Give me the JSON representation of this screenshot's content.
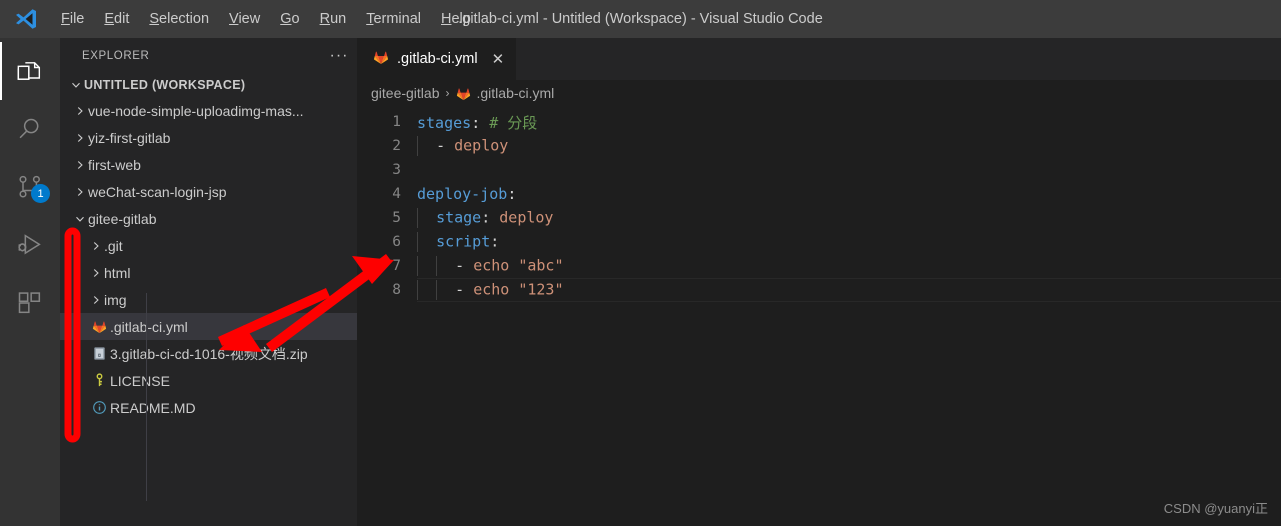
{
  "window": {
    "title": ".gitlab-ci.yml - Untitled (Workspace) - Visual Studio Code",
    "logo_icon": "vscode-logo-icon"
  },
  "menubar": {
    "items": [
      {
        "label": "File",
        "mnemonic": "F",
        "rest": "ile"
      },
      {
        "label": "Edit",
        "mnemonic": "E",
        "rest": "dit"
      },
      {
        "label": "Selection",
        "mnemonic": "S",
        "rest": "election"
      },
      {
        "label": "View",
        "mnemonic": "V",
        "rest": "iew"
      },
      {
        "label": "Go",
        "mnemonic": "G",
        "rest": "o"
      },
      {
        "label": "Run",
        "mnemonic": "R",
        "rest": "un"
      },
      {
        "label": "Terminal",
        "mnemonic": "T",
        "rest": "erminal"
      },
      {
        "label": "Help",
        "mnemonic": "H",
        "rest": "elp"
      }
    ]
  },
  "activitybar": {
    "items": [
      {
        "name": "explorer",
        "icon": "files-icon",
        "active": true,
        "badge": ""
      },
      {
        "name": "search",
        "icon": "search-icon",
        "active": false,
        "badge": ""
      },
      {
        "name": "source-control",
        "icon": "source-control-icon",
        "active": false,
        "badge": "1"
      },
      {
        "name": "run-and-debug",
        "icon": "run-debug-icon",
        "active": false,
        "badge": ""
      },
      {
        "name": "extensions",
        "icon": "extensions-icon",
        "active": false,
        "badge": ""
      }
    ]
  },
  "sidebar": {
    "title": "EXPLORER",
    "more_actions": "···",
    "workspace_root": "UNTITLED (WORKSPACE)",
    "tree": [
      {
        "label": "vue-node-simple-uploadimg-mas...",
        "type": "folder",
        "expanded": false,
        "depth": 1,
        "icon": "chevron-right-icon"
      },
      {
        "label": "yiz-first-gitlab",
        "type": "folder",
        "expanded": false,
        "depth": 1,
        "icon": "chevron-right-icon"
      },
      {
        "label": "first-web",
        "type": "folder",
        "expanded": false,
        "depth": 1,
        "icon": "chevron-right-icon"
      },
      {
        "label": "weChat-scan-login-jsp",
        "type": "folder",
        "expanded": false,
        "depth": 1,
        "icon": "chevron-right-icon"
      },
      {
        "label": "gitee-gitlab",
        "type": "folder",
        "expanded": true,
        "depth": 1,
        "icon": "chevron-down-icon"
      },
      {
        "label": ".git",
        "type": "folder",
        "expanded": false,
        "depth": 2,
        "icon": "chevron-right-icon"
      },
      {
        "label": "html",
        "type": "folder",
        "expanded": false,
        "depth": 2,
        "icon": "chevron-right-icon"
      },
      {
        "label": "img",
        "type": "folder",
        "expanded": false,
        "depth": 2,
        "icon": "chevron-right-icon"
      },
      {
        "label": ".gitlab-ci.yml",
        "type": "file",
        "depth": 2,
        "icon": "gitlab-fox-icon",
        "selected": true
      },
      {
        "label": "3.gitlab-ci-cd-1016-视频文档.zip",
        "type": "file",
        "depth": 2,
        "icon": "zip-archive-icon",
        "selected": false
      },
      {
        "label": "LICENSE",
        "type": "file",
        "depth": 2,
        "icon": "key-icon",
        "selected": false
      },
      {
        "label": "README.MD",
        "type": "file",
        "depth": 2,
        "icon": "info-icon",
        "selected": false
      }
    ]
  },
  "editor": {
    "tab": {
      "label": ".gitlab-ci.yml",
      "icon": "gitlab-fox-icon",
      "close": "✕",
      "active": true
    },
    "breadcrumb": [
      {
        "label": "gitee-gitlab",
        "icon": ""
      },
      {
        "label": ".gitlab-ci.yml",
        "icon": "gitlab-fox-icon"
      }
    ],
    "breadcrumb_separator": "›",
    "language": "yaml",
    "lines": [
      {
        "num": "1",
        "text": "stages: # 分段"
      },
      {
        "num": "2",
        "text": "  - deploy"
      },
      {
        "num": "3",
        "text": ""
      },
      {
        "num": "4",
        "text": "deploy-job:"
      },
      {
        "num": "5",
        "text": "  stage: deploy"
      },
      {
        "num": "6",
        "text": "  script:"
      },
      {
        "num": "7",
        "text": "    - echo \"abc\""
      },
      {
        "num": "8",
        "text": "    - echo \"123\""
      }
    ],
    "current_line": "8"
  },
  "annotations": {
    "red_box": {
      "label": "red-highlight-rectangle",
      "color": "#fe0000"
    },
    "red_arrow": {
      "label": "red-double-arrow",
      "color": "#fe0000"
    }
  },
  "watermark": "CSDN @yuanyi正",
  "colors": {
    "titlebar_bg": "#3c3c3c",
    "activitybar_bg": "#333333",
    "sidebar_bg": "#252526",
    "editor_bg": "#1e1e1e",
    "selection_bg": "#37373d",
    "accent": "#007acc",
    "keyword": "#569cd6",
    "string": "#ce9178",
    "comment": "#6a9955",
    "gitlab_orange": "#e24329",
    "annotation_red": "#fe0000"
  }
}
